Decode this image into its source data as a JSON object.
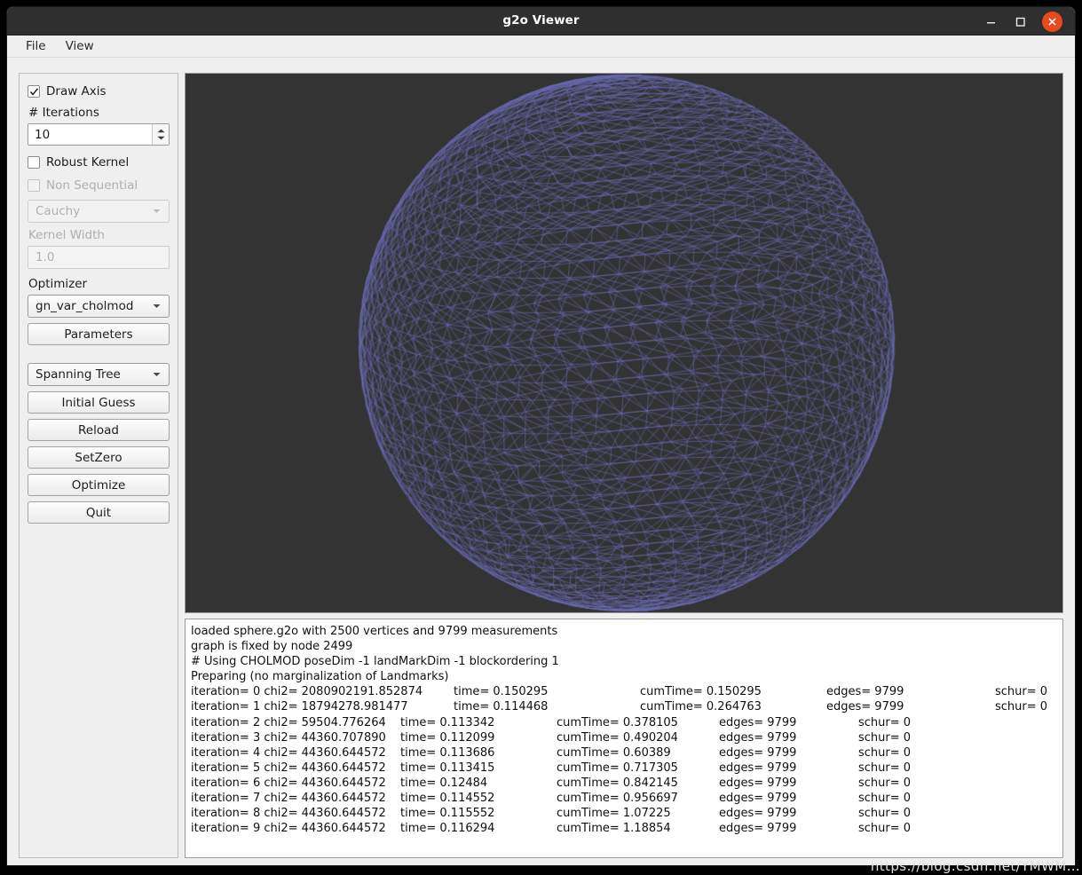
{
  "window": {
    "title": "g2o Viewer",
    "controls": {
      "minimize": "minimize-button",
      "maximize": "maximize-button",
      "close": "close-button"
    },
    "close_color": "#e8491f"
  },
  "menu": {
    "items": [
      {
        "label": "File"
      },
      {
        "label": "View"
      }
    ]
  },
  "sidebar": {
    "draw_axis": {
      "label": "Draw Axis",
      "checked": true
    },
    "iterations": {
      "label": "# Iterations",
      "value": "10"
    },
    "robust_kernel": {
      "label": "Robust Kernel",
      "checked": false
    },
    "non_sequential": {
      "label": "Non Sequential",
      "checked": false,
      "disabled": true
    },
    "kernel_type": {
      "value": "Cauchy",
      "disabled": true
    },
    "kernel_width_label": {
      "label": "Kernel Width",
      "disabled": true
    },
    "kernel_width": {
      "value": "1.0",
      "disabled": true
    },
    "optimizer_label": "Optimizer",
    "optimizer": {
      "value": "gn_var_cholmod"
    },
    "parameters_button": "Parameters",
    "initializer": {
      "value": "Spanning Tree"
    },
    "buttons": [
      {
        "label": "Initial Guess"
      },
      {
        "label": "Reload"
      },
      {
        "label": "SetZero"
      },
      {
        "label": "Optimize"
      },
      {
        "label": "Quit"
      }
    ]
  },
  "viewport": {
    "background_color": "#333333",
    "mesh_color": "#6b6bb5",
    "scene": "sphere wireframe graph"
  },
  "log": {
    "header_lines": [
      "loaded sphere.g2o with 2500 vertices and 9799 measurements",
      "graph is fixed by node 2499",
      "# Using CHOLMOD poseDim -1 landMarkDim -1 blockordering 1",
      "Preparing (no marginalization of Landmarks)"
    ],
    "iterations": [
      {
        "iteration": "iteration= 0 chi2= 2080902191.852874",
        "time": "time= 0.150295",
        "cumTime": "cumTime= 0.150295",
        "edges": "edges= 9799",
        "schur": "schur= 0"
      },
      {
        "iteration": "iteration= 1 chi2= 18794278.981477",
        "time": "time= 0.114468",
        "cumTime": "cumTime= 0.264763",
        "edges": "edges= 9799",
        "schur": "schur= 0"
      },
      {
        "iteration": "iteration= 2 chi2= 59504.776264",
        "time": "time= 0.113342",
        "cumTime": "cumTime= 0.378105",
        "edges": "edges= 9799",
        "schur": "schur= 0"
      },
      {
        "iteration": "iteration= 3 chi2= 44360.707890",
        "time": "time= 0.112099",
        "cumTime": "cumTime= 0.490204",
        "edges": "edges= 9799",
        "schur": "schur= 0"
      },
      {
        "iteration": "iteration= 4 chi2= 44360.644572",
        "time": "time= 0.113686",
        "cumTime": "cumTime= 0.60389",
        "edges": "edges= 9799",
        "schur": "schur= 0"
      },
      {
        "iteration": "iteration= 5 chi2= 44360.644572",
        "time": "time= 0.113415",
        "cumTime": "cumTime= 0.717305",
        "edges": "edges= 9799",
        "schur": "schur= 0"
      },
      {
        "iteration": "iteration= 6 chi2= 44360.644572",
        "time": "time= 0.12484",
        "cumTime": "cumTime= 0.842145",
        "edges": "edges= 9799",
        "schur": "schur= 0"
      },
      {
        "iteration": "iteration= 7 chi2= 44360.644572",
        "time": "time= 0.114552",
        "cumTime": "cumTime= 0.956697",
        "edges": "edges= 9799",
        "schur": "schur= 0"
      },
      {
        "iteration": "iteration= 8 chi2= 44360.644572",
        "time": "time= 0.115552",
        "cumTime": "cumTime= 1.07225",
        "edges": "edges= 9799",
        "schur": "schur= 0"
      },
      {
        "iteration": "iteration= 9 chi2= 44360.644572",
        "time": "time= 0.116294",
        "cumTime": "cumTime= 1.18854",
        "edges": "edges= 9799",
        "schur": "schur= 0"
      }
    ]
  },
  "watermark": {
    "text": "https://blog.csdn.net/YMWM…"
  }
}
